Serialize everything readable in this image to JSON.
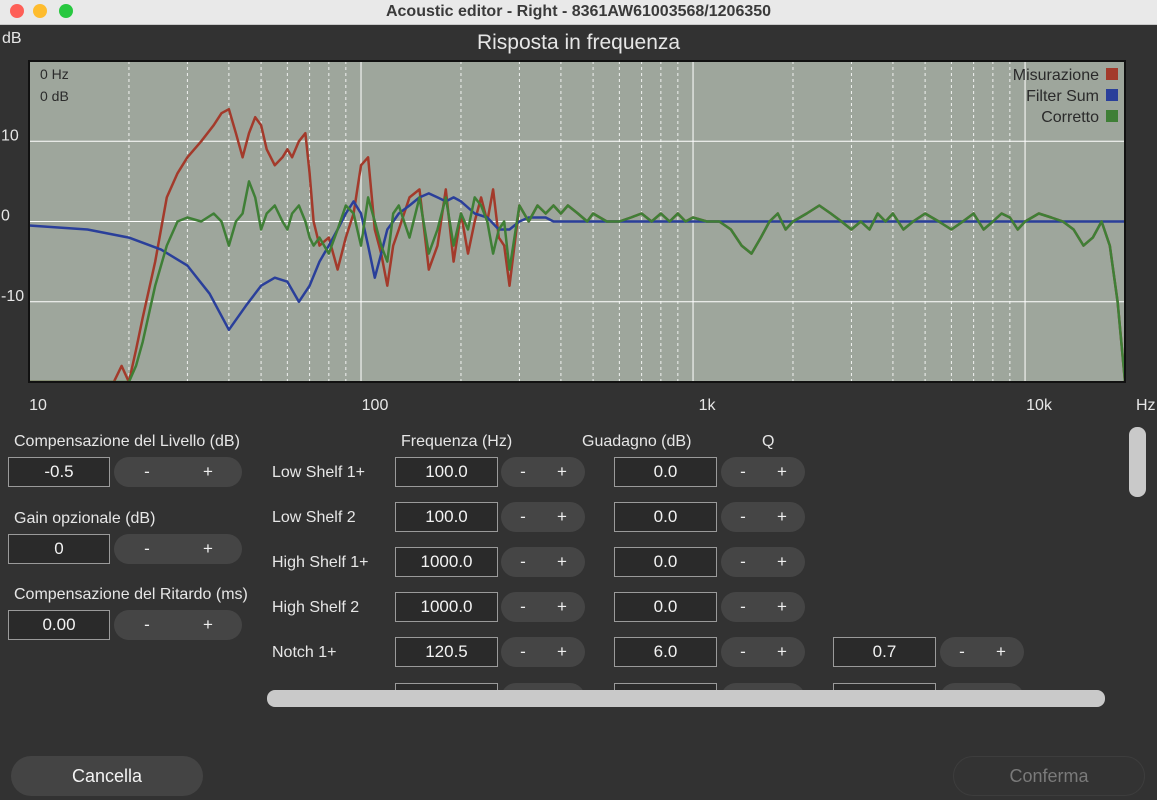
{
  "window": {
    "title": "Acoustic editor - Right - 8361AW61003568/1206350"
  },
  "chart_data": {
    "type": "line",
    "title": "Risposta in frequenza",
    "xlabel": "Hz",
    "ylabel": "dB",
    "x_scale": "log",
    "xlim": [
      10,
      20000
    ],
    "ylim": [
      -20,
      20
    ],
    "x_ticks": [
      10,
      100,
      1000,
      10000
    ],
    "x_tick_labels": [
      "10",
      "100",
      "1k",
      "10k"
    ],
    "y_ticks": [
      10,
      0,
      -10
    ],
    "y_tick_labels": [
      "10",
      "0",
      "-10"
    ],
    "cursor_readout": [
      "0 Hz",
      "0 dB"
    ],
    "grid": true,
    "legend_position": "top-right",
    "series": [
      {
        "name": "Misurazione",
        "color": "#a33a2b",
        "x": [
          10,
          18,
          19,
          20,
          21,
          22,
          24,
          26,
          28,
          30,
          33,
          36,
          38,
          40,
          42,
          44,
          46,
          48,
          50,
          52,
          55,
          58,
          60,
          62,
          65,
          68,
          70,
          72,
          75,
          80,
          85,
          90,
          95,
          100,
          105,
          110,
          115,
          120,
          125,
          130,
          140,
          150,
          160,
          170,
          180,
          190,
          200,
          210,
          220,
          230,
          240,
          250,
          260,
          270,
          280,
          300,
          320,
          340,
          360,
          380,
          400,
          420,
          450,
          480,
          500,
          550,
          600,
          650,
          700,
          750,
          800,
          850,
          900,
          950,
          1000,
          1100,
          1200,
          1300,
          1400,
          1500,
          1600,
          1700,
          1800,
          1900,
          2000,
          2200,
          2400,
          2600,
          2800,
          3000,
          3200,
          3400,
          3600,
          3800,
          4000,
          4300,
          4600,
          5000,
          5500,
          6000,
          6500,
          7000,
          7500,
          8000,
          8500,
          9000,
          9500,
          10000,
          11000,
          12000,
          13000,
          14000,
          15000,
          16000,
          17000,
          18000,
          19000,
          20000
        ],
        "y": [
          -20,
          -20,
          -18,
          -20,
          -16,
          -12,
          -5,
          3,
          6,
          8,
          10,
          12,
          13.5,
          14,
          11,
          8,
          11,
          13,
          12,
          9,
          7,
          8,
          9,
          8,
          10,
          11,
          6,
          0,
          -3,
          -2,
          -6,
          -2,
          1,
          7,
          8,
          -1,
          -4,
          -8,
          -3,
          -1,
          3,
          4,
          -6,
          -3,
          4,
          -5,
          1,
          -4,
          0,
          3,
          0,
          4,
          -2,
          -3,
          -8,
          2,
          0,
          2,
          1,
          2,
          1,
          2,
          1,
          0,
          1,
          0,
          0,
          0.5,
          1,
          0,
          1,
          0,
          1,
          0,
          0.5,
          0,
          0,
          -1,
          -3,
          -4,
          -2,
          0,
          1,
          -1,
          0,
          1,
          2,
          1,
          0,
          -1,
          0,
          -1,
          1,
          0,
          1,
          -1,
          0,
          1,
          0,
          -1,
          0,
          1,
          -1,
          0,
          1,
          0.5,
          -1,
          0,
          1,
          0.5,
          0,
          -1,
          -3,
          -2,
          0,
          -3,
          -10,
          -20
        ]
      },
      {
        "name": "Filter Sum",
        "color": "#2a3f9a",
        "x": [
          10,
          15,
          20,
          25,
          30,
          35,
          40,
          45,
          50,
          55,
          60,
          65,
          70,
          75,
          80,
          85,
          90,
          95,
          100,
          105,
          110,
          115,
          120,
          125,
          130,
          140,
          150,
          160,
          170,
          180,
          190,
          200,
          220,
          240,
          260,
          280,
          300,
          320,
          340,
          360,
          380,
          400,
          450,
          500,
          600,
          700,
          800,
          1000,
          2000,
          5000,
          10000,
          20000
        ],
        "y": [
          -0.5,
          -1,
          -2,
          -3.5,
          -5.5,
          -9,
          -13.5,
          -10.5,
          -8,
          -7,
          -7.5,
          -10,
          -8,
          -5,
          -3,
          -1,
          1,
          2.5,
          1,
          -3,
          -7,
          -4,
          -1,
          0,
          1,
          2,
          3,
          3.5,
          3,
          2.5,
          3,
          2.5,
          1,
          0.5,
          -1,
          -1,
          0,
          0.5,
          0.5,
          0.5,
          0,
          0,
          0,
          0,
          0,
          0,
          0,
          0,
          0,
          0,
          0,
          0
        ]
      },
      {
        "name": "Corretto",
        "color": "#3f7f36",
        "x": [
          10,
          20,
          21,
          22,
          24,
          26,
          28,
          30,
          33,
          36,
          38,
          40,
          42,
          44,
          46,
          48,
          50,
          52,
          55,
          58,
          60,
          62,
          65,
          68,
          70,
          72,
          75,
          80,
          85,
          90,
          95,
          100,
          105,
          110,
          115,
          120,
          125,
          130,
          140,
          150,
          160,
          170,
          180,
          190,
          200,
          210,
          220,
          230,
          240,
          250,
          260,
          270,
          280,
          300,
          320,
          340,
          360,
          380,
          400,
          420,
          450,
          480,
          500,
          550,
          600,
          650,
          700,
          750,
          800,
          850,
          900,
          950,
          1000,
          1100,
          1200,
          1300,
          1400,
          1500,
          1600,
          1700,
          1800,
          1900,
          2000,
          2200,
          2400,
          2600,
          2800,
          3000,
          3200,
          3400,
          3600,
          3800,
          4000,
          4300,
          4600,
          5000,
          5500,
          6000,
          6500,
          7000,
          7500,
          8000,
          8500,
          9000,
          9500,
          10000,
          11000,
          12000,
          13000,
          14000,
          15000,
          16000,
          17000,
          18000,
          19000,
          20000
        ],
        "y": [
          -20,
          -20,
          -18,
          -15,
          -8,
          -3,
          0,
          0.5,
          0,
          1,
          0,
          -3,
          0,
          1,
          5,
          3,
          -1,
          1,
          2,
          0,
          -1,
          1,
          2,
          0,
          -2,
          -3,
          -2,
          -4,
          -1,
          2,
          1,
          -3,
          3,
          0,
          -3,
          -5,
          1,
          2,
          -2,
          3,
          -4,
          -1,
          3,
          -3,
          1,
          -1,
          3,
          2,
          0,
          -4,
          -1,
          0,
          -6,
          2,
          0,
          2,
          1,
          2,
          1,
          2,
          1,
          0,
          1,
          0,
          0,
          0.5,
          1,
          0,
          1,
          0,
          1,
          0,
          0.5,
          0,
          0,
          -1,
          -3,
          -4,
          -2,
          0,
          1,
          -1,
          0,
          1,
          2,
          1,
          0,
          -1,
          0,
          -1,
          1,
          0,
          1,
          -1,
          0,
          1,
          0,
          -1,
          0,
          1,
          -1,
          0,
          1,
          0.5,
          -1,
          0,
          1,
          0.5,
          0,
          -1,
          -3,
          -2,
          0,
          -3,
          -10,
          -20
        ]
      }
    ]
  },
  "left_panel": {
    "level_label": "Compensazione del Livello (dB)",
    "level_value": "-0.5",
    "gain_label": "Gain opzionale (dB)",
    "gain_value": "0",
    "delay_label": "Compensazione del Ritardo (ms)",
    "delay_value": "0.00"
  },
  "filters": {
    "headers": {
      "freq": "Frequenza (Hz)",
      "gain": "Guadagno (dB)",
      "q": "Q"
    },
    "rows": [
      {
        "name": "Low Shelf 1+",
        "freq": "100.0",
        "gain": "0.0",
        "q": ""
      },
      {
        "name": "Low Shelf 2",
        "freq": "100.0",
        "gain": "0.0",
        "q": ""
      },
      {
        "name": "High Shelf 1+",
        "freq": "1000.0",
        "gain": "0.0",
        "q": ""
      },
      {
        "name": "High Shelf 2",
        "freq": "1000.0",
        "gain": "0.0",
        "q": ""
      },
      {
        "name": "Notch 1+",
        "freq": "120.5",
        "gain": "6.0",
        "q": "0.7"
      }
    ]
  },
  "controls": {
    "minus": "-",
    "plus": "+"
  },
  "footer": {
    "cancel": "Cancella",
    "confirm": "Conferma"
  }
}
